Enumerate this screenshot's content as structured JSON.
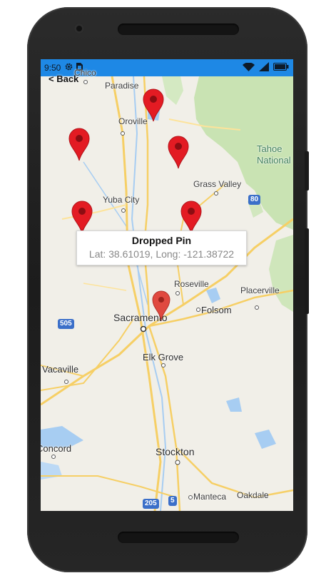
{
  "status_bar": {
    "time": "9:50",
    "icons": [
      "gear-icon",
      "sim-card-icon"
    ],
    "right_icons": [
      "wifi-icon",
      "signal-icon",
      "battery-icon"
    ]
  },
  "nav": {
    "back_label": "< Back"
  },
  "map": {
    "labels": {
      "chico": "Chico",
      "paradise": "Paradise",
      "oroville": "Oroville",
      "tahoe_national": "Tahoe National",
      "grass_valley": "Grass Valley",
      "yuba_city": "Yuba City",
      "roseville": "Roseville",
      "placerville": "Placerville",
      "sacramento": "Sacramento",
      "folsom": "Folsom",
      "elk_grove": "Elk Grove",
      "vacaville": "Vacaville",
      "concord": "Concord",
      "stockton": "Stockton",
      "manteca": "Manteca",
      "oakdale": "Oakdale"
    },
    "shields": {
      "i80": "80",
      "i505": "505",
      "i205": "205",
      "i5": "5"
    },
    "pin_color": "#e31b23",
    "dropped_pin_color": "#e0493f"
  },
  "callout": {
    "title": "Dropped Pin",
    "subtitle": "Lat: 38.61019, Long: -121.38722"
  }
}
